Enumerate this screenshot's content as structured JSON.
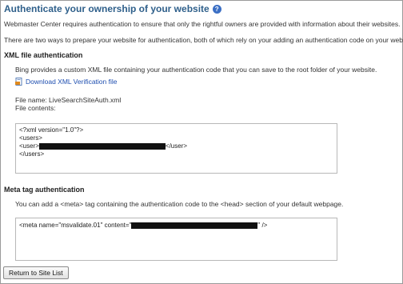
{
  "header": {
    "title": "Authenticate your ownership of your website",
    "help_icon": "?"
  },
  "intro": {
    "line1": "Webmaster Center requires authentication to ensure that only the rightful owners are provided with information about their websites.",
    "line2": "There are two ways to prepare your website for authentication, both of which rely on your adding an authentication code on your website."
  },
  "xml_section": {
    "heading": "XML file authentication",
    "description": "Bing provides a custom XML file containing your authentication code that you can save to the root folder of your website.",
    "download_link": "Download XML Verification file",
    "file_name": "File name: LiveSearchSiteAuth.xml",
    "file_contents_label": "File contents:",
    "code_lines": {
      "l1": "<?xml version=\"1.0\"?>",
      "l2": "<users>",
      "l3_prefix": "<user>",
      "l3_suffix": "</user>",
      "l4": "</users>"
    }
  },
  "meta_section": {
    "heading": "Meta tag authentication",
    "description": "You can add a <meta> tag containing the authentication code to the <head> section of your default webpage.",
    "code_prefix": "<meta name=\"msvalidate.01\" content=\"",
    "code_suffix": "\" />"
  },
  "footer": {
    "return_button": "Return to Site List"
  }
}
